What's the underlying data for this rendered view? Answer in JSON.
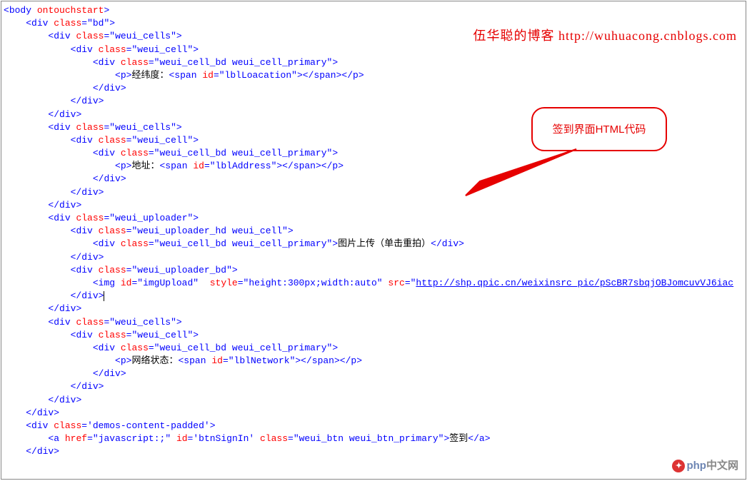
{
  "watermark": {
    "blog_title": "伍华聪的博客 http://wuhuacong.cnblogs.com",
    "bubble_text": "签到界面HTML代码",
    "site_brand_cn": "中文网",
    "site_brand_php": "php"
  },
  "code": {
    "tag_body": "body",
    "attr_ontouchstart": "ontouchstart",
    "tag_div": "div",
    "tag_p": "p",
    "tag_span": "span",
    "tag_img": "img",
    "tag_a": "a",
    "attr_class": "class",
    "attr_id": "id",
    "attr_style": "style",
    "attr_src": "src",
    "attr_href": "href",
    "val_bd": "bd",
    "val_weui_cells": "weui_cells",
    "val_weui_cell": "weui_cell",
    "val_weui_cell_bd_primary": "weui_cell_bd weui_cell_primary",
    "val_weui_uploader": "weui_uploader",
    "val_weui_uploader_hd_cell": "weui_uploader_hd weui_cell",
    "val_weui_uploader_bd": "weui_uploader_bd",
    "val_demos_content_padded": "demos-content-padded",
    "val_weui_btn_primary": "weui_btn weui_btn_primary",
    "val_lblLoacation": "lblLoacation",
    "val_lblAddress": "lblAddress",
    "val_lblNetwork": "lblNetwork",
    "val_imgUpload": "imgUpload",
    "val_btnSignIn": "btnSignIn",
    "val_style_img": "height:300px;width:auto",
    "val_img_src": "http://shp.qpic.cn/weixinsrc_pic/pScBR7sbqjOBJomcuvVJ6iac",
    "val_href_js": "javascript:;",
    "txt_jingweidu": "经纬度：",
    "txt_dizhi": "地址：",
    "txt_tupian": "图片上传（单击重拍）",
    "txt_wangluo": "网络状态：",
    "txt_qiandao": "签到"
  }
}
